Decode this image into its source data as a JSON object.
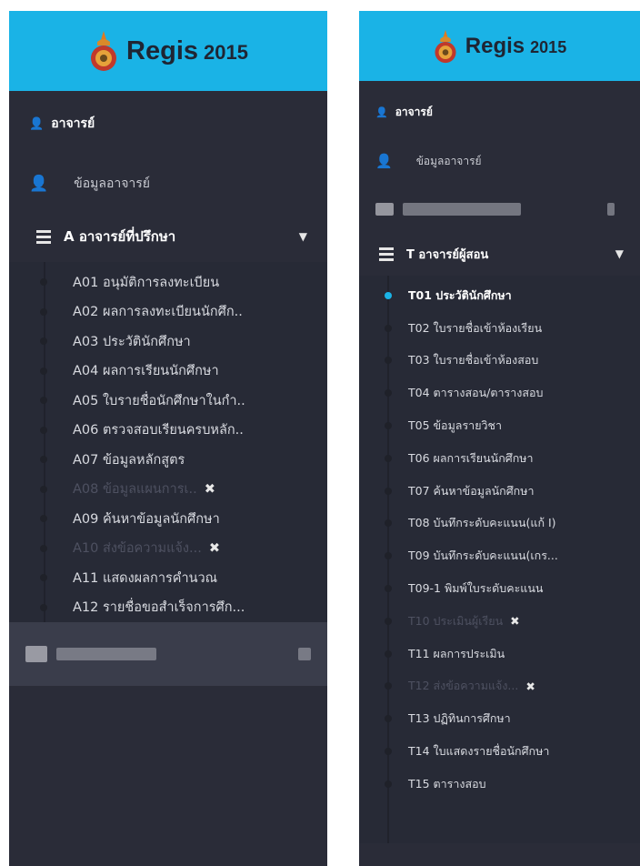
{
  "colors": {
    "brand_bg": "#1ab3e6",
    "sidebar_bg": "#2a2c38",
    "active_dot": "#1ab3e6"
  },
  "left": {
    "brand": {
      "name": "Regis",
      "year": "2015"
    },
    "section_title": "อาจารย์",
    "menu_item": "ข้อมูลอาจารย์",
    "group_title": "A อาจารย์ที่ปรึกษา",
    "items": [
      {
        "label": "A01 อนุมัติการลงทะเบียน",
        "disabled": false
      },
      {
        "label": "A02 ผลการลงทะเบียนนักศึก..",
        "disabled": false
      },
      {
        "label": "A03 ประวัตินักศึกษา",
        "disabled": false
      },
      {
        "label": "A04 ผลการเรียนนักศึกษา",
        "disabled": false
      },
      {
        "label": "A05 ใบรายชื่อนักศึกษาในกำ..",
        "disabled": false
      },
      {
        "label": "A06 ตรวจสอบเรียนครบหลัก..",
        "disabled": false
      },
      {
        "label": "A07 ข้อมูลหลักสูตร",
        "disabled": false
      },
      {
        "label": "A08 ข้อมูลแผนการเ..",
        "disabled": true,
        "close": "✖"
      },
      {
        "label": "A09 ค้นหาข้อมูลนักศึกษา",
        "disabled": false
      },
      {
        "label": "A10 ส่งข้อความแจ้ง...",
        "disabled": true,
        "close": "✖"
      },
      {
        "label": "A11 แสดงผลการคำนวณ",
        "disabled": false
      },
      {
        "label": "A12 รายชื่อขอสำเร็จการศึก...",
        "disabled": false
      }
    ]
  },
  "right": {
    "brand": {
      "name": "Regis",
      "year": "2015"
    },
    "section_title": "อาจารย์",
    "menu_item": "ข้อมูลอาจารย์",
    "group_title": "T อาจารย์ผู้สอน",
    "items": [
      {
        "label": "T01 ประวัตินักศึกษา",
        "active": true
      },
      {
        "label": "T02 ใบรายชื่อเข้าห้องเรียน"
      },
      {
        "label": "T03 ใบรายชื่อเข้าห้องสอบ"
      },
      {
        "label": "T04 ตารางสอน/ตารางสอบ"
      },
      {
        "label": "T05 ข้อมูลรายวิชา"
      },
      {
        "label": "T06 ผลการเรียนนักศึกษา"
      },
      {
        "label": "T07 ค้นหาข้อมูลนักศึกษา"
      },
      {
        "label": "T08 บันทึกระดับคะแนน(แก้ I)"
      },
      {
        "label": "T09 บันทึกระดับคะแนน(เกร..."
      },
      {
        "label": "T09-1 พิมพ์ใบระดับคะแนน"
      },
      {
        "label": "T10 ประเมินผู้เรียน",
        "disabled": true,
        "close": "✖"
      },
      {
        "label": "T11 ผลการประเมิน"
      },
      {
        "label": "T12 ส่งข้อความแจ้ง...",
        "disabled": true,
        "close": "✖"
      },
      {
        "label": "T13 ปฏิทินการศึกษา"
      },
      {
        "label": "T14 ใบแสดงรายชื่อนักศึกษา"
      },
      {
        "label": "T15 ตารางสอบ"
      }
    ]
  }
}
